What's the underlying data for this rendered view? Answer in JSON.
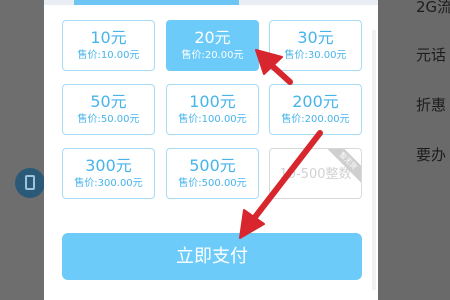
{
  "background": {
    "right_texts": [
      "2G流",
      "元话",
      "折惠",
      "要办"
    ]
  },
  "recharge": {
    "options": [
      {
        "price": "10元",
        "sale": "售价:10.00元",
        "state": "normal"
      },
      {
        "price": "20元",
        "sale": "售价:20.00元",
        "state": "selected"
      },
      {
        "price": "30元",
        "sale": "售价:30.00元",
        "state": "normal"
      },
      {
        "price": "50元",
        "sale": "售价:50.00元",
        "state": "normal"
      },
      {
        "price": "100元",
        "sale": "售价:100.00元",
        "state": "normal"
      },
      {
        "price": "200元",
        "sale": "售价:200.00元",
        "state": "normal"
      },
      {
        "price": "300元",
        "sale": "售价:300.00元",
        "state": "normal"
      },
      {
        "price": "500元",
        "sale": "售价:500.00元",
        "state": "normal"
      }
    ],
    "custom_placeholder": "10-500整数",
    "custom_ribbon": "暂无货",
    "pay_button": "立即支付"
  },
  "colors": {
    "accent": "#6ccbf8",
    "card_border": "#a6dcf5",
    "card_text": "#47b4eb",
    "arrow": "#d7262e"
  }
}
